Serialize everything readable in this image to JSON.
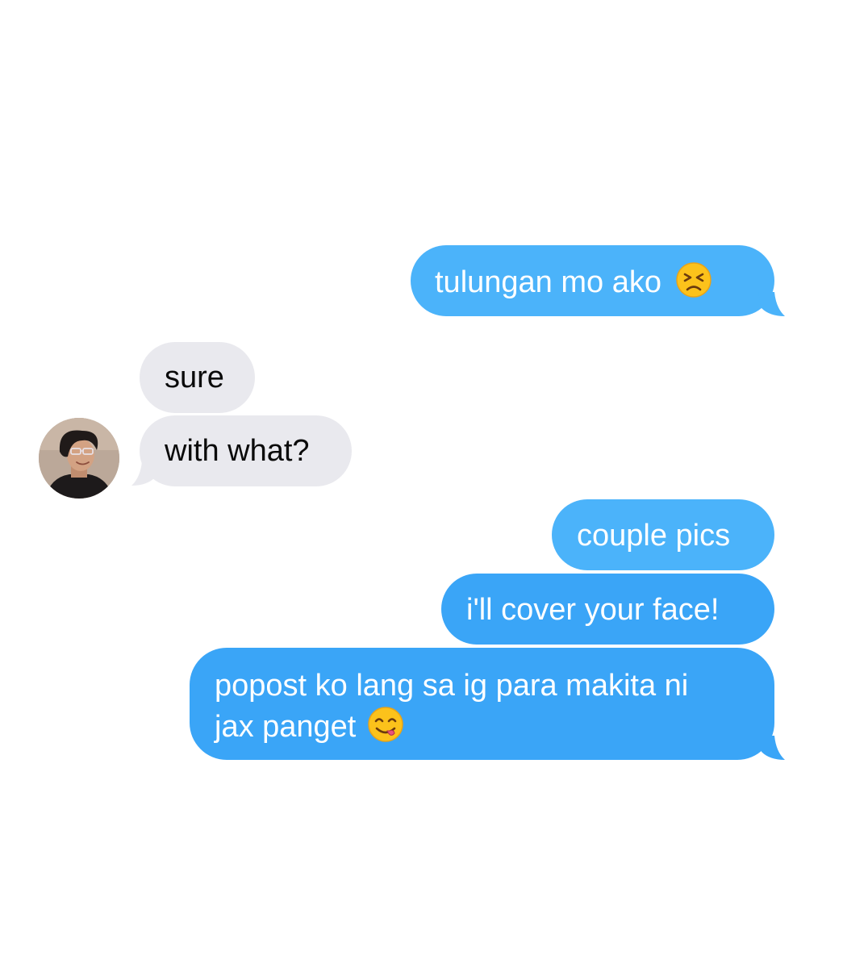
{
  "thread": {
    "messages": [
      {
        "id": "m1",
        "direction": "outgoing",
        "text": "tulungan mo ako",
        "emoji": "persevering-face-emoji"
      },
      {
        "id": "m2",
        "direction": "incoming",
        "text": "sure"
      },
      {
        "id": "m3",
        "direction": "incoming",
        "text": "with what?"
      },
      {
        "id": "m4",
        "direction": "outgoing",
        "text": "couple pics"
      },
      {
        "id": "m5",
        "direction": "outgoing",
        "text": "i'll cover your face!"
      },
      {
        "id": "m6",
        "direction": "outgoing",
        "line1": "popost ko lang sa ig para makita ni",
        "line2": "jax panget",
        "emoji": "face-savoring-food-emoji"
      }
    ]
  },
  "colors": {
    "outgoing_bubble": "#3aa5f7",
    "incoming_bubble": "#e9e9ee",
    "outgoing_text": "#ffffff",
    "incoming_text": "#0a0a0a",
    "background": "#ffffff"
  },
  "icons": {
    "avatar": "contact-avatar",
    "emoji_1": "persevering-face-emoji",
    "emoji_2": "face-savoring-food-emoji"
  }
}
